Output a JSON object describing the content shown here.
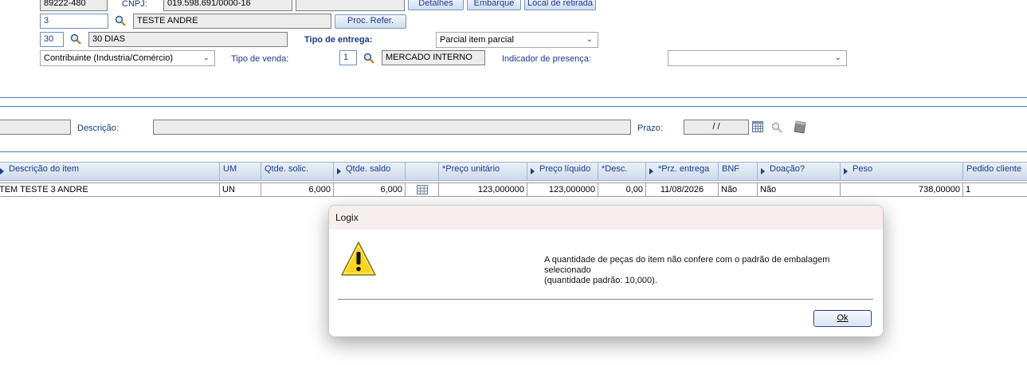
{
  "header": {
    "cep_value": "89222-480",
    "cnpj_label": "CNPJ:",
    "cnpj_value": "019.598.691/0000-16",
    "extra_value": "",
    "btn_detalhes": "Detalhes",
    "btn_embarque": "Embarque",
    "btn_local_retirada": "Local de retirada",
    "client_code": "3",
    "client_name": "TESTE ANDRE",
    "btn_proc_refer": "Proc. Refer.",
    "cond_code": "30",
    "cond_name": "30 DIAS",
    "tipo_entrega_label": "Tipo de entrega:",
    "tipo_entrega_value": "Parcial item parcial",
    "contribuinte_value": "Contribuinte (Industria/Comércio)",
    "tipo_venda_label": "Tipo de venda:",
    "tipo_venda_code": "1",
    "tipo_venda_name": "MERCADO INTERNO",
    "indicador_label": "Indicador de presença:",
    "indicador_value": ""
  },
  "item_filter": {
    "item_value": "",
    "descricao_label": "Descrição:",
    "descricao_value": "",
    "prazo_label": "Prazo:",
    "prazo_value": "/ /"
  },
  "grid": {
    "headers": [
      "Descrição do item",
      "UM",
      "Qtde. solic.",
      "Qtde. saldo",
      "",
      "*Preço unitário",
      "Preço líquido",
      "*Desc.",
      "*Prz. entrega",
      "BNF",
      "Doação?",
      "Peso",
      "Pedido cliente"
    ],
    "rows": [
      [
        "TEM TESTE 3 ANDRE",
        "UN",
        "6,000",
        "6,000",
        "",
        "123,000000",
        "123,000000",
        "0,00",
        "11/08/2026",
        "Não",
        "Não",
        "738,00000",
        "1"
      ]
    ]
  },
  "dialog": {
    "title": "Logix",
    "icon": "warning-icon",
    "message_line1": "A quantidade de peças do item não confere com o padrão de embalagem selecionado",
    "message_line2": "(quantidade padrão: 10,000).",
    "ok_label": "Ok"
  }
}
